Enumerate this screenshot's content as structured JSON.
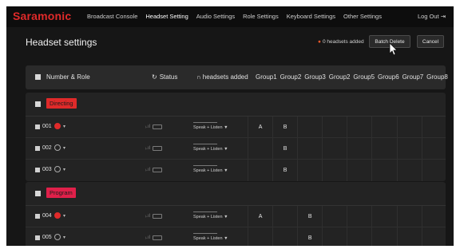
{
  "nav": {
    "brand": "Saramonic",
    "items": [
      {
        "label": "Broadcast Console",
        "active": false
      },
      {
        "label": "Headset Setting",
        "active": true
      },
      {
        "label": "Audio Settings",
        "active": false
      },
      {
        "label": "Role Settings",
        "active": false
      },
      {
        "label": "Keyboard Settings",
        "active": false
      },
      {
        "label": "Other Settings",
        "active": false
      }
    ],
    "logout": "Log Out ⇥"
  },
  "header": {
    "title": "Headset settings",
    "added_count": "0 headsets added",
    "batch_delete": "Batch Delete",
    "cancel": "Cancel"
  },
  "columns": {
    "number_role": "Number & Role",
    "status": "Status",
    "headsets_added": "headsets added",
    "groups": [
      "Group1",
      "Group2",
      "Group3",
      "Group2",
      "Group5",
      "Group6",
      "Group7",
      "Group8"
    ]
  },
  "colors": {
    "accent": "#e02a2a",
    "role_tag_program": "#e0204a",
    "background": "#161616"
  },
  "icons": {
    "status": "refresh-icon",
    "headset": "headset-icon",
    "signal": "signal-icon",
    "battery": "battery-icon"
  },
  "panels": [
    {
      "role": "Directing",
      "rows": [
        {
          "number": "001",
          "online": true,
          "mode": "Speak + Listen ▼",
          "groups": [
            "A",
            "B",
            "",
            "",
            "",
            "",
            "",
            ""
          ]
        },
        {
          "number": "002",
          "online": false,
          "mode": "Speak + Listen ▼",
          "groups": [
            "",
            "B",
            "",
            "",
            "",
            "",
            "",
            ""
          ]
        },
        {
          "number": "003",
          "online": false,
          "mode": "Speak + Listen ▼",
          "groups": [
            "",
            "B",
            "",
            "",
            "",
            "",
            "",
            ""
          ]
        }
      ]
    },
    {
      "role": "Program",
      "rows": [
        {
          "number": "004",
          "online": true,
          "mode": "Speak + Listen ▼",
          "groups": [
            "A",
            "",
            "B",
            "",
            "",
            "",
            "",
            ""
          ]
        },
        {
          "number": "005",
          "online": false,
          "mode": "Speak + Listen ▼",
          "groups": [
            "",
            "",
            "B",
            "",
            "",
            "",
            "",
            ""
          ]
        }
      ]
    }
  ]
}
